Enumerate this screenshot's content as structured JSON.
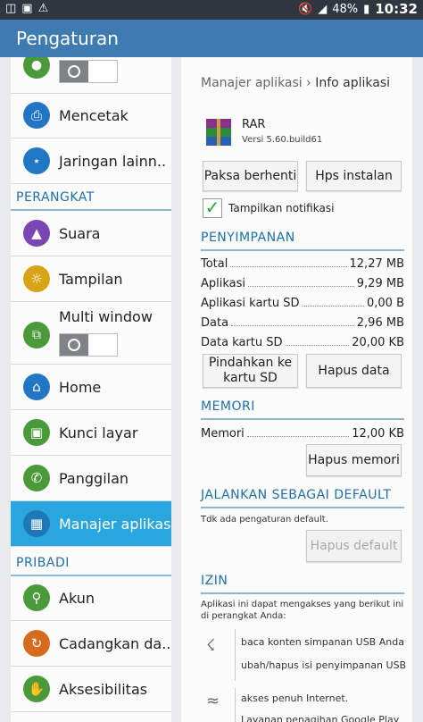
{
  "statusbar": {
    "battery": "48%",
    "time": "10:32"
  },
  "actionbar": {
    "title": "Pengaturan"
  },
  "left": {
    "items": [
      {
        "label": "Mencetak"
      },
      {
        "label": "Jaringan lainn.."
      },
      {
        "label": "Suara"
      },
      {
        "label": "Tampilan"
      },
      {
        "label": "Multi window"
      },
      {
        "label": "Home"
      },
      {
        "label": "Kunci layar"
      },
      {
        "label": "Panggilan"
      },
      {
        "label": "Manajer aplikasi"
      },
      {
        "label": "Akun"
      },
      {
        "label": "Cadangkan da.."
      },
      {
        "label": "Aksesibilitas"
      }
    ],
    "categories": {
      "device": "PERANGKAT",
      "personal": "PRIBADI"
    }
  },
  "right": {
    "breadcrumb": {
      "parent": "Manajer aplikasi",
      "current": "Info aplikasi"
    },
    "app": {
      "name": "RAR",
      "version": "Versi 5.60.build61"
    },
    "buttons": {
      "force_stop": "Paksa berhenti",
      "uninstall": "Hps instalan",
      "move": "Pindahkan ke kartu SD",
      "clear_data": "Hapus data",
      "clear_memory": "Hapus memori",
      "clear_defaults": "Hapus default"
    },
    "notifications_label": "Tampilkan notifikasi",
    "storage": {
      "header": "PENYIMPANAN",
      "rows": [
        {
          "label": "Total",
          "value": "12,27 MB"
        },
        {
          "label": "Aplikasi",
          "value": "9,29 MB"
        },
        {
          "label": "Aplikasi kartu SD",
          "value": "0,00 B"
        },
        {
          "label": "Data",
          "value": "2,96 MB"
        },
        {
          "label": "Data kartu SD",
          "value": "20,00 KB"
        }
      ]
    },
    "memory": {
      "header": "MEMORI",
      "label": "Memori",
      "value": "12,00 KB"
    },
    "defaults": {
      "header": "JALANKAN SEBAGAI DEFAULT",
      "text": "Tdk ada pengaturan default."
    },
    "permissions": {
      "header": "IZIN",
      "intro": "Aplikasi ini dapat mengakses yang berikut ini di perangkat Anda:",
      "groups": [
        {
          "lines": [
            "baca konten simpanan USB Anda",
            "ubah/hapus isi penyimpanan USB"
          ]
        },
        {
          "lines": [
            "akses penuh Internet.",
            "Layanan penagihan Google Play"
          ]
        }
      ]
    }
  }
}
